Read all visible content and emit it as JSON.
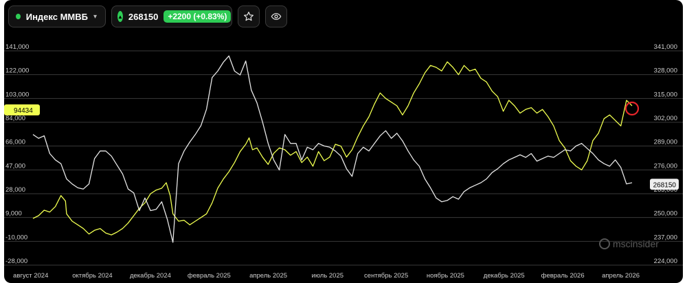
{
  "toolbar": {
    "ticker_name": "Индекс ММВБ",
    "price": "268150",
    "change": "+2200 (+0.83%)",
    "colors": {
      "status": "#2ecc55"
    },
    "icons": [
      "status-dot",
      "chevron-down-icon",
      "triangle-up-icon",
      "star-icon",
      "eye-icon"
    ]
  },
  "watermark": "mscinsider",
  "chart_data": {
    "type": "line",
    "grid": "horizontal",
    "x_ticks": [
      "август 2024",
      "октябрь 2024",
      "декабрь 2024",
      "февраль 2025",
      "апрель 2025",
      "июль 2025",
      "сентябрь 2025",
      "ноябрь 2025",
      "декабрь 2025",
      "февраль 2026",
      "апрель 2026"
    ],
    "x_range": [
      0,
      100
    ],
    "x_tick_positions": [
      1.9,
      12.1,
      21.7,
      31.4,
      41.2,
      51.0,
      60.7,
      70.5,
      80.2,
      89.9,
      99.5
    ],
    "left_axis": {
      "ticks": [
        "141,000",
        "122,000",
        "103,000",
        "84,000",
        "66,000",
        "47,000",
        "28,000",
        "9,000",
        "-10,000",
        "-28,000"
      ],
      "range": [
        -28000,
        141000
      ]
    },
    "right_axis": {
      "ticks": [
        "341,000",
        "328,000",
        "315,000",
        "302,000",
        "289,000",
        "276,000",
        "263,000",
        "250,000",
        "237,000",
        "224,000"
      ],
      "range": [
        224000,
        341000
      ]
    },
    "series": [
      {
        "axis": "right",
        "color": "#f0ff50",
        "last_label": "94434",
        "last_label_axis": "left",
        "last_value": 94434,
        "points": [
          [
            0,
            249500
          ],
          [
            1,
            251000
          ],
          [
            2,
            254000
          ],
          [
            3,
            253000
          ],
          [
            4,
            256000
          ],
          [
            5,
            262000
          ],
          [
            5.8,
            259000
          ],
          [
            6,
            252000
          ],
          [
            7,
            248000
          ],
          [
            8,
            246000
          ],
          [
            9,
            244000
          ],
          [
            10,
            241000
          ],
          [
            11,
            243000
          ],
          [
            12,
            244000
          ],
          [
            13,
            241500
          ],
          [
            14,
            240500
          ],
          [
            15,
            242000
          ],
          [
            16,
            244000
          ],
          [
            17,
            247000
          ],
          [
            18,
            251000
          ],
          [
            19,
            255000
          ],
          [
            20,
            258000
          ],
          [
            21,
            263000
          ],
          [
            22,
            265000
          ],
          [
            23,
            266000
          ],
          [
            23.8,
            269000
          ],
          [
            24.5,
            262000
          ],
          [
            25,
            252000
          ],
          [
            26,
            248000
          ],
          [
            27,
            248500
          ],
          [
            28,
            246000
          ],
          [
            29,
            248000
          ],
          [
            30,
            250000
          ],
          [
            31,
            252000
          ],
          [
            32,
            258000
          ],
          [
            33,
            266000
          ],
          [
            34,
            271000
          ],
          [
            35,
            275000
          ],
          [
            36,
            280000
          ],
          [
            37,
            286000
          ],
          [
            38,
            290000
          ],
          [
            38.6,
            293500
          ],
          [
            39.2,
            287000
          ],
          [
            40,
            288000
          ],
          [
            41,
            283000
          ],
          [
            42,
            279000
          ],
          [
            43,
            285000
          ],
          [
            44,
            288000
          ],
          [
            45,
            287000
          ],
          [
            46,
            284000
          ],
          [
            47,
            286000
          ],
          [
            48,
            280000
          ],
          [
            49,
            283000
          ],
          [
            50,
            278000
          ],
          [
            51,
            286000
          ],
          [
            52,
            281000
          ],
          [
            53,
            283000
          ],
          [
            54,
            290000
          ],
          [
            55,
            289000
          ],
          [
            56,
            283000
          ],
          [
            57,
            287000
          ],
          [
            58,
            294000
          ],
          [
            59,
            300000
          ],
          [
            60,
            305000
          ],
          [
            61,
            312000
          ],
          [
            62,
            318000
          ],
          [
            63,
            315000
          ],
          [
            64,
            313000
          ],
          [
            65,
            311000
          ],
          [
            66,
            306000
          ],
          [
            67,
            311000
          ],
          [
            68,
            318000
          ],
          [
            69,
            323000
          ],
          [
            70,
            329000
          ],
          [
            71,
            333000
          ],
          [
            72,
            332000
          ],
          [
            73,
            330000
          ],
          [
            74,
            335000
          ],
          [
            75,
            332000
          ],
          [
            76,
            328000
          ],
          [
            77,
            333000
          ],
          [
            78,
            330000
          ],
          [
            79,
            331000
          ],
          [
            80,
            326000
          ],
          [
            81,
            324000
          ],
          [
            82,
            319000
          ],
          [
            83,
            316000
          ],
          [
            84,
            308000
          ],
          [
            85,
            314000
          ],
          [
            86,
            311000
          ],
          [
            87,
            307000
          ],
          [
            88,
            309000
          ],
          [
            89,
            310000
          ],
          [
            90,
            307000
          ],
          [
            91,
            309000
          ],
          [
            92,
            305000
          ],
          [
            93,
            300000
          ],
          [
            94,
            292000
          ],
          [
            95,
            288000
          ],
          [
            96,
            281000
          ],
          [
            97,
            278000
          ],
          [
            98,
            276000
          ],
          [
            99,
            281000
          ],
          [
            100,
            292000
          ],
          [
            101,
            296000
          ],
          [
            102,
            304000
          ],
          [
            103,
            306000
          ],
          [
            104,
            303000
          ],
          [
            105,
            300000
          ],
          [
            106,
            314000
          ],
          [
            107,
            311000
          ]
        ]
      },
      {
        "axis": "left",
        "color": "#e6e6e6",
        "last_label": "268150",
        "last_label_axis": "right",
        "last_value": 268150,
        "points": [
          [
            0,
            75000
          ],
          [
            1,
            72000
          ],
          [
            2,
            74000
          ],
          [
            3,
            60000
          ],
          [
            4,
            55000
          ],
          [
            5,
            52000
          ],
          [
            6,
            40000
          ],
          [
            7,
            36000
          ],
          [
            8,
            33000
          ],
          [
            9,
            32000
          ],
          [
            10,
            36000
          ],
          [
            11,
            56000
          ],
          [
            12,
            62000
          ],
          [
            13,
            62000
          ],
          [
            14,
            58000
          ],
          [
            15,
            51000
          ],
          [
            16,
            44000
          ],
          [
            17,
            32000
          ],
          [
            18,
            29000
          ],
          [
            19,
            15000
          ],
          [
            20,
            25000
          ],
          [
            21,
            15000
          ],
          [
            22,
            16000
          ],
          [
            23,
            22000
          ],
          [
            24,
            8000
          ],
          [
            25,
            -10000
          ],
          [
            26,
            52000
          ],
          [
            27,
            62000
          ],
          [
            28,
            69000
          ],
          [
            29,
            75000
          ],
          [
            30,
            82000
          ],
          [
            31,
            95000
          ],
          [
            32,
            120000
          ],
          [
            33,
            125000
          ],
          [
            34,
            132000
          ],
          [
            35,
            137000
          ],
          [
            36,
            125000
          ],
          [
            37,
            122000
          ],
          [
            38,
            133000
          ],
          [
            39,
            110000
          ],
          [
            40,
            100000
          ],
          [
            41,
            85000
          ],
          [
            42,
            68000
          ],
          [
            43,
            55000
          ],
          [
            44,
            47000
          ],
          [
            45,
            75000
          ],
          [
            46,
            68000
          ],
          [
            47,
            68000
          ],
          [
            48,
            55000
          ],
          [
            49,
            65000
          ],
          [
            50,
            63000
          ],
          [
            51,
            68000
          ],
          [
            52,
            66000
          ],
          [
            53,
            65000
          ],
          [
            54,
            62000
          ],
          [
            55,
            58000
          ],
          [
            56,
            48000
          ],
          [
            57,
            42000
          ],
          [
            58,
            60000
          ],
          [
            59,
            65000
          ],
          [
            60,
            62000
          ],
          [
            61,
            68000
          ],
          [
            62,
            74000
          ],
          [
            63,
            78000
          ],
          [
            64,
            72000
          ],
          [
            65,
            76000
          ],
          [
            66,
            70000
          ],
          [
            67,
            62000
          ],
          [
            68,
            55000
          ],
          [
            69,
            50000
          ],
          [
            70,
            40000
          ],
          [
            71,
            33000
          ],
          [
            72,
            25000
          ],
          [
            73,
            22000
          ],
          [
            74,
            23000
          ],
          [
            75,
            26000
          ],
          [
            76,
            24000
          ],
          [
            77,
            30000
          ],
          [
            78,
            33000
          ],
          [
            79,
            35000
          ],
          [
            80,
            37000
          ],
          [
            81,
            40000
          ],
          [
            82,
            45000
          ],
          [
            83,
            48000
          ],
          [
            84,
            52000
          ],
          [
            85,
            55000
          ],
          [
            86,
            57000
          ],
          [
            87,
            59000
          ],
          [
            88,
            57000
          ],
          [
            89,
            60000
          ],
          [
            90,
            54000
          ],
          [
            91,
            56000
          ],
          [
            92,
            58000
          ],
          [
            93,
            57000
          ],
          [
            94,
            60000
          ],
          [
            95,
            63000
          ],
          [
            96,
            62000
          ],
          [
            97,
            66000
          ],
          [
            98,
            68000
          ],
          [
            99,
            64000
          ],
          [
            100,
            60000
          ],
          [
            101,
            55000
          ],
          [
            102,
            52000
          ],
          [
            103,
            50000
          ],
          [
            104,
            55000
          ],
          [
            105,
            49000
          ],
          [
            106,
            36000
          ],
          [
            107,
            37000
          ]
        ]
      }
    ]
  }
}
